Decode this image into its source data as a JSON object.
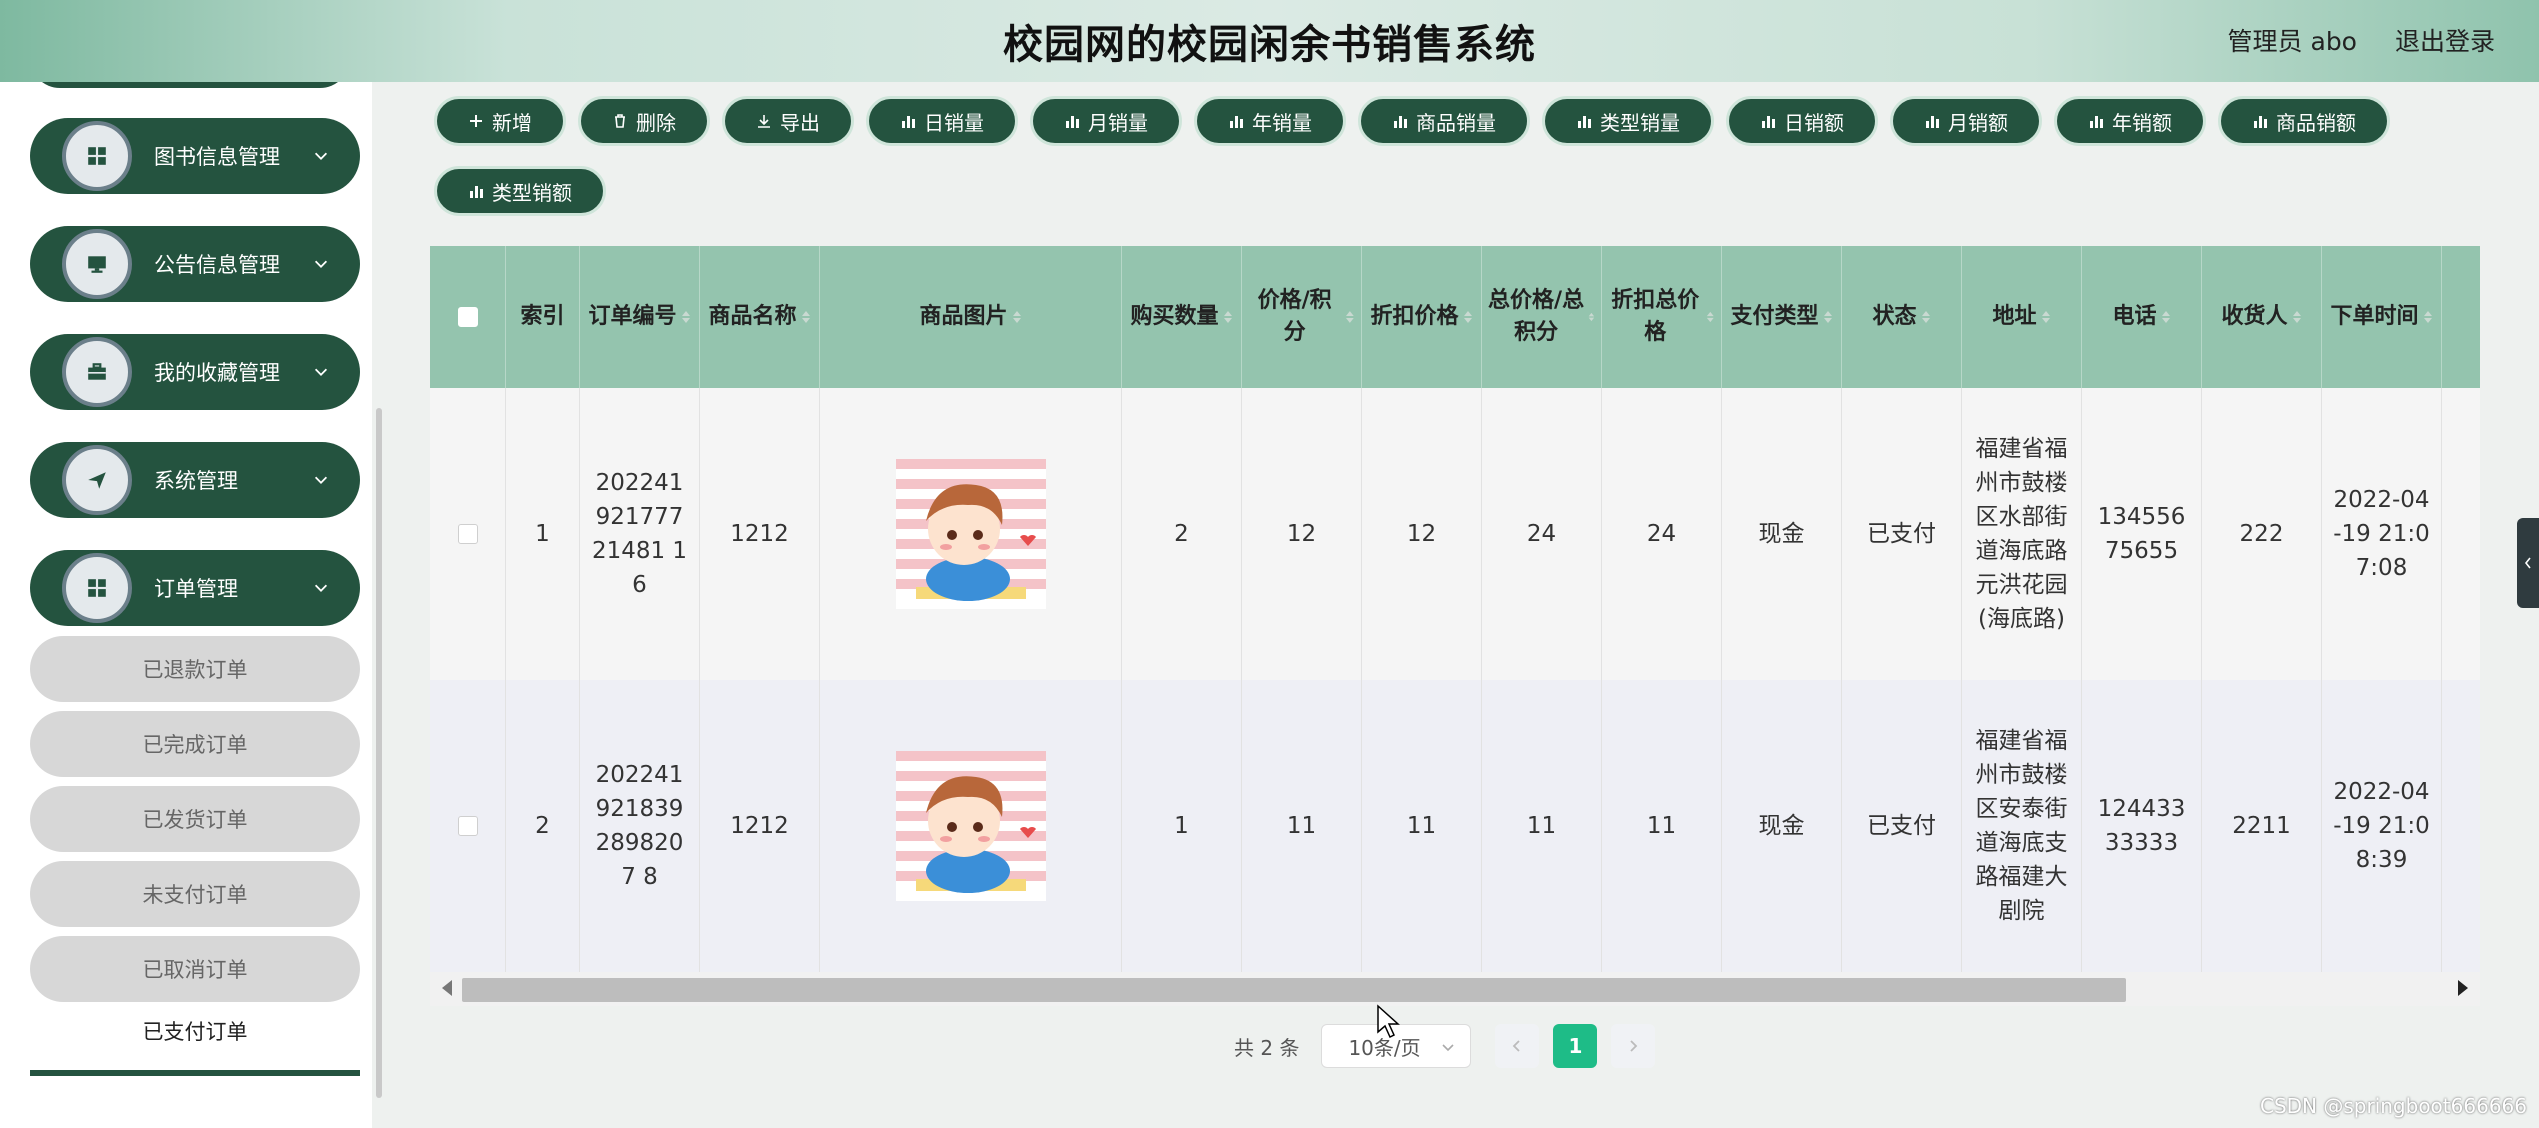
{
  "header": {
    "title": "校园网的校园闲余书销售系统",
    "user": "管理员 abo",
    "logout": "退出登录"
  },
  "sidebar": {
    "menu": [
      {
        "label": "图书信息管理",
        "icon": "grid-icon"
      },
      {
        "label": "公告信息管理",
        "icon": "monitor-icon"
      },
      {
        "label": "我的收藏管理",
        "icon": "briefcase-icon"
      },
      {
        "label": "系统管理",
        "icon": "send-icon"
      },
      {
        "label": "订单管理",
        "icon": "grid-icon"
      }
    ],
    "sub_items": [
      "已退款订单",
      "已完成订单",
      "已发货订单",
      "未支付订单",
      "已取消订单",
      "已支付订单"
    ],
    "active_sub": "已支付订单"
  },
  "toolbar": {
    "buttons": [
      "新增",
      "删除",
      "导出",
      "日销量",
      "月销量",
      "年销量",
      "商品销量",
      "类型销量",
      "日销额",
      "月销额",
      "年销额",
      "商品销额",
      "类型销额"
    ]
  },
  "table": {
    "headers": [
      "索引",
      "订单编号",
      "商品名称",
      "商品图片",
      "购买数量",
      "价格/积分",
      "折扣价格",
      "总价格/总积分",
      "折扣总价格",
      "支付类型",
      "状态",
      "地址",
      "电话",
      "收货人",
      "下单时间"
    ],
    "rows": [
      {
        "index": "1",
        "order_no": "20224192177721481 16",
        "product": "1212",
        "qty": "2",
        "price": "12",
        "discount_price": "12",
        "total": "24",
        "discount_total": "24",
        "pay_type": "现金",
        "status": "已支付",
        "address": "福建省福州市鼓楼区水部街道海底路元洪花园(海底路)",
        "phone": "13455675655",
        "receiver": "222",
        "time": "2022-04-19 21:07:08"
      },
      {
        "index": "2",
        "order_no": "2022419218392898207 8",
        "product": "1212",
        "qty": "1",
        "price": "11",
        "discount_price": "11",
        "total": "11",
        "discount_total": "11",
        "pay_type": "现金",
        "status": "已支付",
        "address": "福建省福州市鼓楼区安泰街道海底支路福建大剧院",
        "phone": "12443333333",
        "receiver": "2211",
        "time": "2022-04-19 21:08:39"
      }
    ]
  },
  "pagination": {
    "total": "共 2 条",
    "page_size": "10条/页",
    "current": "1"
  },
  "watermark": "CSDN @springboot666666",
  "colors": {
    "primary": "#24533f",
    "header_bg": "#94c4ae",
    "active_page": "#1ebc87"
  }
}
